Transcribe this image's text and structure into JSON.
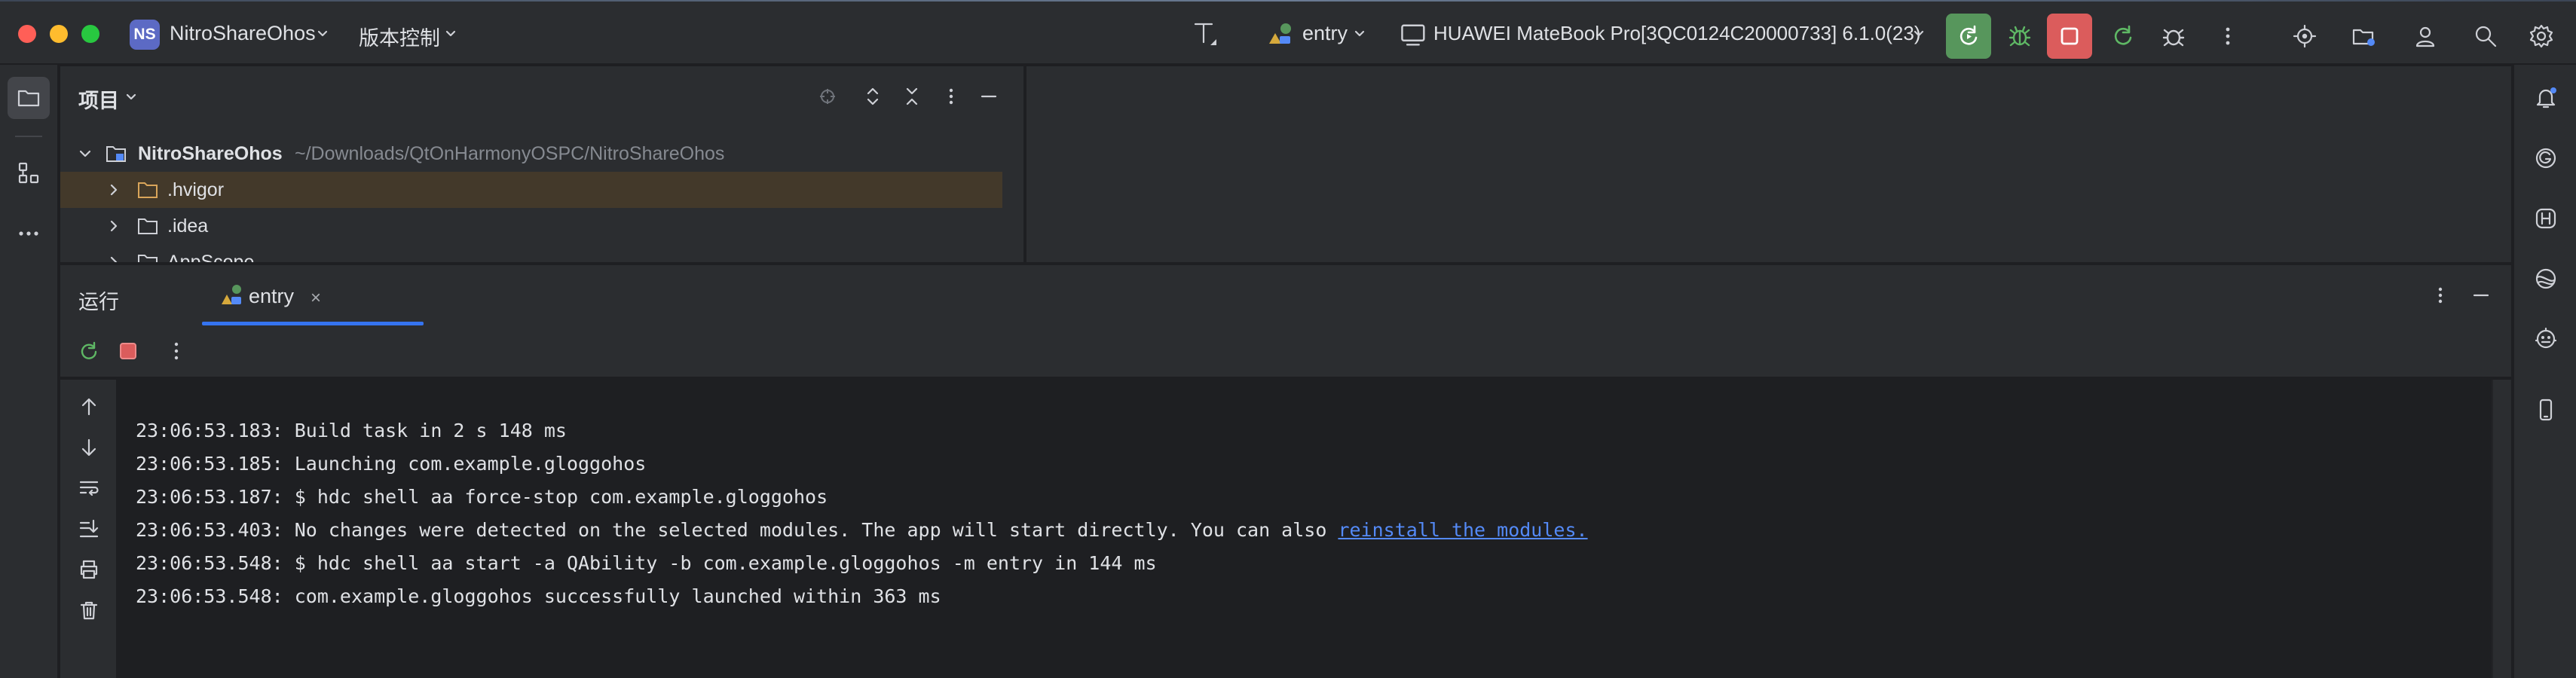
{
  "titlebar": {
    "project_badge": "NS",
    "project_name": "NitroShareOhos",
    "vcs_menu": "版本控制",
    "run_config": "entry",
    "device": "HUAWEI MateBook Pro[3QC0124C20000733] 6.1.0(23)"
  },
  "project_panel": {
    "title": "项目",
    "tree": [
      {
        "label": "NitroShareOhos",
        "path": "~/Downloads/QtOnHarmonyOSPC/NitroShareOhos",
        "expanded": true
      },
      {
        "label": ".hvigor",
        "selected": true
      },
      {
        "label": ".idea"
      },
      {
        "label": "AppScope"
      }
    ]
  },
  "run_panel": {
    "title": "运行",
    "tab_label": "entry",
    "tab_close": "×"
  },
  "console": {
    "lines": [
      {
        "text": "23:06:53.183: Build task in 2 s 148 ms"
      },
      {
        "text": "23:06:53.185: Launching com.example.gloggohos"
      },
      {
        "text": "23:06:53.187: $ hdc shell aa force-stop com.example.gloggohos"
      },
      {
        "text": "23:06:53.403: No changes were detected on the selected modules. The app will start directly. You can also ",
        "link": "reinstall the modules."
      },
      {
        "text": "23:06:53.548: $ hdc shell aa start -a QAbility -b com.example.gloggohos -m entry in 144 ms"
      },
      {
        "text": "23:06:53.548: com.example.gloggohos successfully launched within 363 ms"
      }
    ]
  },
  "colors": {
    "accent_blue": "#3574f0",
    "run_green": "#57965c",
    "stop_red": "#db5c5c",
    "debug_green": "#5fb865",
    "selection_orange": "#43392a",
    "link": "#548af7"
  },
  "icons": {
    "left_strip": [
      "folder-icon",
      "structure-icon",
      "more-icon"
    ],
    "right_strip": [
      "notifications-icon",
      "codegenie-icon",
      "harmony-h-icon",
      "inspect-icon",
      "ai-assistant-icon",
      "device-manager-icon"
    ]
  }
}
